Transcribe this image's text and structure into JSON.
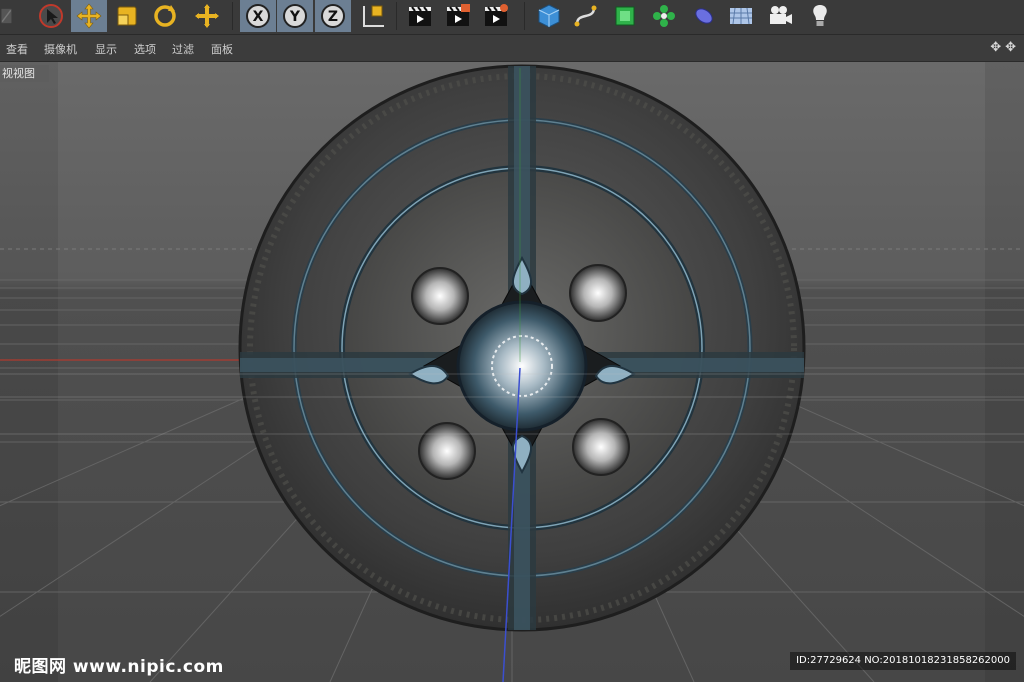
{
  "colors": {
    "toolbar_bg": "#3a3a3a",
    "active_button": "#6c7f93",
    "viewport_bg": "#4d4d4d",
    "accent_yellow": "#e8b322",
    "axis_red": "#c0392b",
    "axis_blue": "#3b4fd0"
  },
  "toolbar": {
    "buttons": [
      {
        "icon": "select-arrow-icon"
      },
      {
        "icon": "move-icon"
      },
      {
        "icon": "scale-icon"
      },
      {
        "icon": "rotate-icon"
      },
      {
        "icon": "live-selection-icon"
      },
      {
        "icon": "x-axis-icon",
        "label": "X"
      },
      {
        "icon": "y-axis-icon",
        "label": "Y"
      },
      {
        "icon": "z-axis-icon",
        "label": "Z"
      },
      {
        "icon": "coordinate-system-icon"
      },
      {
        "icon": "render-view-icon"
      },
      {
        "icon": "render-to-picture-viewer-icon"
      },
      {
        "icon": "render-settings-icon"
      },
      {
        "icon": "cube-icon"
      },
      {
        "icon": "spline-pen-icon"
      },
      {
        "icon": "subdivision-surface-icon"
      },
      {
        "icon": "array-icon"
      },
      {
        "icon": "deformer-icon"
      },
      {
        "icon": "floor-icon"
      },
      {
        "icon": "camera-icon"
      },
      {
        "icon": "light-icon"
      }
    ]
  },
  "menu": {
    "items": [
      "查看",
      "摄像机",
      "显示",
      "选项",
      "过滤",
      "面板"
    ],
    "nav_icons": "✥✥"
  },
  "viewport": {
    "label": "视视图"
  },
  "watermark": {
    "site": "昵图网 www.nipic.com",
    "id": "ID:27729624 NO:20181018231858262000"
  }
}
